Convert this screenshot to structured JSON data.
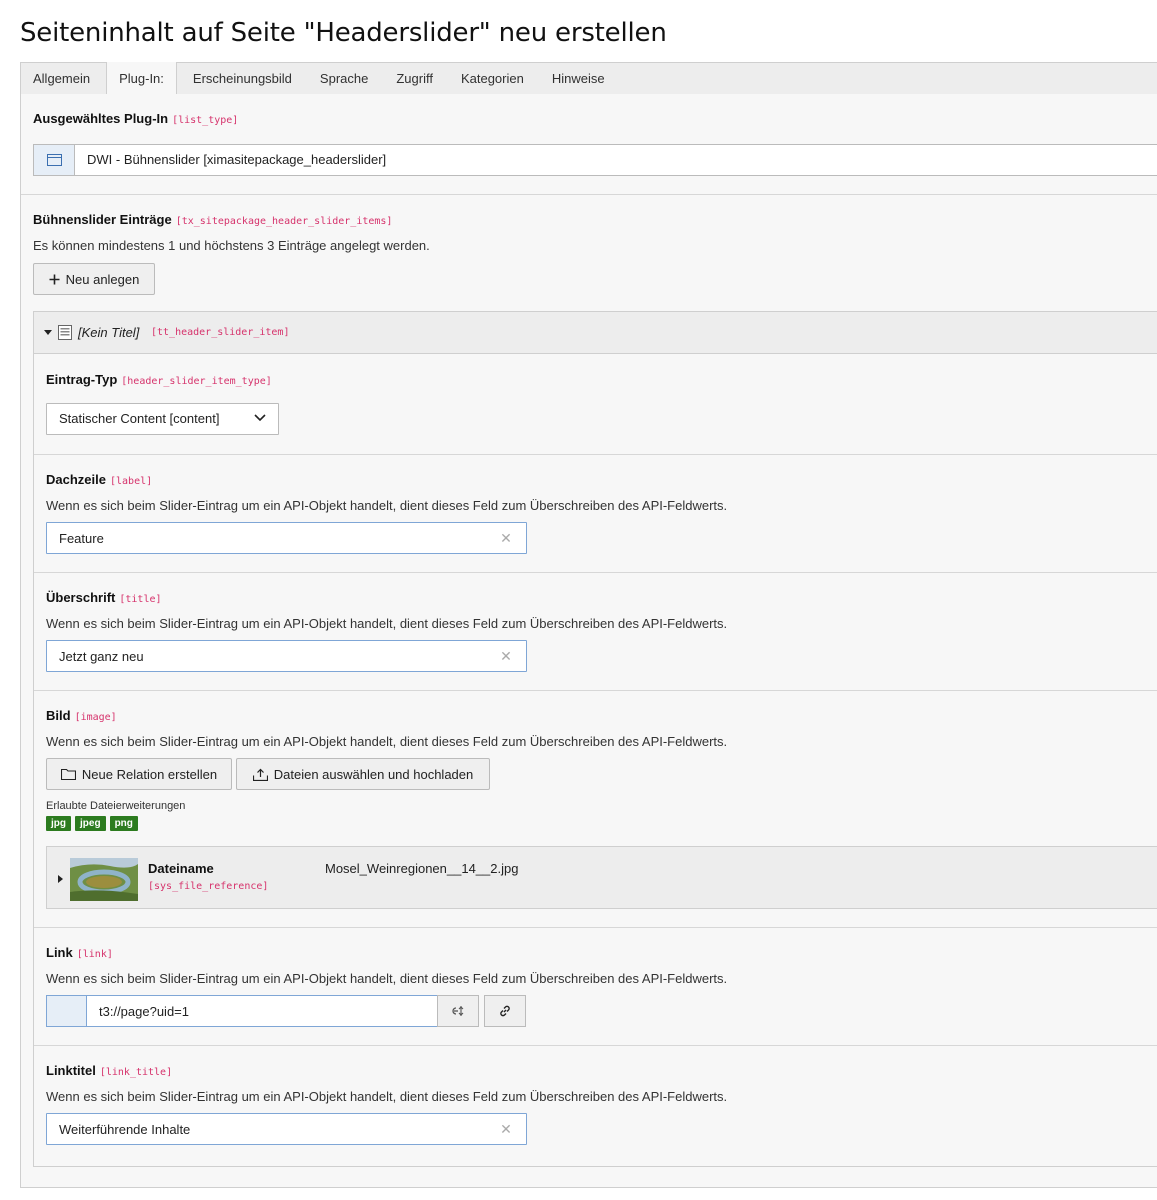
{
  "page": {
    "title": "Seiteninhalt auf Seite \"Headerslider\" neu erstellen"
  },
  "tabs": [
    {
      "label": "Allgemein"
    },
    {
      "label": "Plug-In:"
    },
    {
      "label": "Erscheinungsbild"
    },
    {
      "label": "Sprache"
    },
    {
      "label": "Zugriff"
    },
    {
      "label": "Kategorien"
    },
    {
      "label": "Hinweise"
    }
  ],
  "active_tab": "Plug-In:",
  "plugin": {
    "label": "Ausgewähltes Plug-In",
    "tech": "[list_type]",
    "value": "DWI - Bühnenslider [ximasitepackage_headerslider]"
  },
  "slider_items": {
    "label": "Bühnenslider Einträge",
    "tech": "[tx_sitepackage_header_slider_items]",
    "description": "Es können mindestens 1 und höchstens 3 Einträge angelegt werden.",
    "new_button": "Neu anlegen"
  },
  "record": {
    "title": "[Kein Titel]",
    "tech": "[tt_header_slider_item]"
  },
  "fields": {
    "type": {
      "label": "Eintrag-Typ",
      "tech": "[header_slider_item_type]",
      "value": "Statischer Content [content]"
    },
    "dachzeile": {
      "label": "Dachzeile",
      "tech": "[label]",
      "description": "Wenn es sich beim Slider-Eintrag um ein API-Objekt handelt, dient dieses Feld zum Überschreiben des API-Feldwerts.",
      "value": "Feature"
    },
    "ueberschrift": {
      "label": "Überschrift",
      "tech": "[title]",
      "description": "Wenn es sich beim Slider-Eintrag um ein API-Objekt handelt, dient dieses Feld zum Überschreiben des API-Feldwerts.",
      "value": "Jetzt ganz neu"
    },
    "bild": {
      "label": "Bild",
      "tech": "[image]",
      "description": "Wenn es sich beim Slider-Eintrag um ein API-Objekt handelt, dient dieses Feld zum Überschreiben des API-Feldwerts.",
      "new_relation_button": "Neue Relation erstellen",
      "upload_button": "Dateien auswählen und hochladen",
      "allowed_label": "Erlaubte Dateierweiterungen",
      "extensions": [
        "jpg",
        "jpeg",
        "png"
      ],
      "file_label": "Dateiname",
      "file_tech": "[sys_file_reference]",
      "file_name": "Mosel_Weinregionen__14__2.jpg"
    },
    "link": {
      "label": "Link",
      "tech": "[link]",
      "description": "Wenn es sich beim Slider-Eintrag um ein API-Objekt handelt, dient dieses Feld zum Überschreiben des API-Feldwerts.",
      "value": "t3://page?uid=1"
    },
    "linktitel": {
      "label": "Linktitel",
      "tech": "[link_title]",
      "description": "Wenn es sich beim Slider-Eintrag um ein API-Objekt handelt, dient dieses Feld zum Überschreiben des API-Feldwerts.",
      "value": "Weiterführende Inhalte"
    }
  },
  "icons": {
    "clear": "clear-icon",
    "plus": "plus-icon",
    "folder": "folder-icon",
    "upload": "upload-icon",
    "link": "link-icon",
    "browse": "link-browse-icon"
  }
}
